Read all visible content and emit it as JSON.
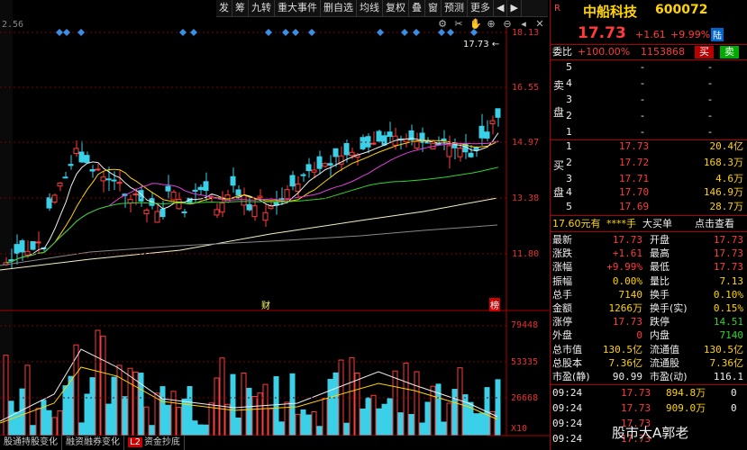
{
  "toolbar": {
    "items": [
      "发",
      "筹",
      "九转",
      "重大事件",
      "删自选",
      "均线",
      "复权",
      "叠",
      "窗",
      "预测",
      "更多"
    ],
    "active_index": 3
  },
  "icons": [
    "gear-icon",
    "scissors-icon",
    "hand-icon",
    "zoom-in-icon",
    "zoom-out-icon",
    "prev-icon",
    "close-icon"
  ],
  "chart": {
    "top_left_value": "2.56",
    "price_ticks": [
      "18.13",
      "16.55",
      "14.97",
      "13.38",
      "11.80"
    ],
    "price_marker": "17.73",
    "markers": {
      "cai": "财",
      "bang": "榜"
    },
    "volume_ticks": [
      "79448",
      "53335",
      "26668"
    ],
    "volume_unit": "X10"
  },
  "bottom_tabs": [
    {
      "label": "股通持股变化"
    },
    {
      "label": "融资融券变化"
    },
    {
      "num": "L2",
      "label": "资金抄底"
    }
  ],
  "quote": {
    "logo": "R",
    "name": "中船科技",
    "code": "600072",
    "price": "17.73",
    "change": "+1.61",
    "change_pct": "+9.99%",
    "exchange_badge": "陆",
    "ratio_label": "委比",
    "ratio_value": "+100.00%",
    "ratio_diff": "1153868",
    "buy_btn": "买",
    "sell_btn": "卖",
    "sell_label": [
      "卖",
      "盘"
    ],
    "buy_label": [
      "买",
      "盘"
    ],
    "sell_orders": [
      {
        "lvl": "5",
        "price": "-",
        "vol": "-"
      },
      {
        "lvl": "4",
        "price": "-",
        "vol": "-"
      },
      {
        "lvl": "3",
        "price": "-",
        "vol": "-"
      },
      {
        "lvl": "2",
        "price": "-",
        "vol": "-"
      },
      {
        "lvl": "1",
        "price": "-",
        "vol": "-"
      }
    ],
    "buy_orders": [
      {
        "lvl": "1",
        "price": "17.73",
        "vol": "20.4亿"
      },
      {
        "lvl": "2",
        "price": "17.72",
        "vol": "168.3万"
      },
      {
        "lvl": "3",
        "price": "17.71",
        "vol": "4.6万"
      },
      {
        "lvl": "4",
        "price": "17.70",
        "vol": "146.9万"
      },
      {
        "lvl": "5",
        "price": "17.69",
        "vol": "28.7万"
      }
    ],
    "big_order": {
      "text1": "17.60元有",
      "text2": "****手",
      "text3": "大买单",
      "link": "点击查看"
    },
    "stats": [
      {
        "l1": "最新",
        "v1": "17.73",
        "c1": "red",
        "l2": "开盘",
        "v2": "17.73",
        "c2": "red"
      },
      {
        "l1": "涨跌",
        "v1": "+1.61",
        "c1": "red",
        "l2": "最高",
        "v2": "17.73",
        "c2": "red"
      },
      {
        "l1": "涨幅",
        "v1": "+9.99%",
        "c1": "red",
        "l2": "最低",
        "v2": "17.73",
        "c2": "red"
      },
      {
        "l1": "振幅",
        "v1": "0.00%",
        "c1": "yellow",
        "l2": "量比",
        "v2": "7.13",
        "c2": "yellow"
      },
      {
        "l1": "总手",
        "v1": "7140",
        "c1": "yellow",
        "l2": "换手",
        "v2": "0.10%",
        "c2": "yellow"
      },
      {
        "l1": "金额",
        "v1": "1266万",
        "c1": "yellow",
        "l2": "换手(实)",
        "v2": "0.15%",
        "c2": "yellow"
      },
      {
        "l1": "涨停",
        "v1": "17.73",
        "c1": "red",
        "l2": "跌停",
        "v2": "14.51",
        "c2": "green"
      },
      {
        "l1": "外盘",
        "v1": "0",
        "c1": "red",
        "l2": "内盘",
        "v2": "7140",
        "c2": "green"
      },
      {
        "l1": "总市值",
        "v1": "130.5亿",
        "c1": "yellow",
        "l2": "流通值",
        "v2": "130.5亿",
        "c2": "yellow"
      },
      {
        "l1": "总股本",
        "v1": "7.36亿",
        "c1": "yellow",
        "l2": "流通股",
        "v2": "7.36亿",
        "c2": "yellow"
      },
      {
        "l1": "市盈(静)",
        "v1": "90.99",
        "c1": "white",
        "l2": "市盈(动)",
        "v2": "116.1",
        "c2": "white"
      }
    ],
    "ticks": [
      {
        "time": "09:24",
        "price": "17.73",
        "vol": "894.8万",
        "n": "0"
      },
      {
        "time": "09:24",
        "price": "17.73",
        "vol": "909.0万",
        "n": "0"
      },
      {
        "time": "09:24",
        "price": "17.73",
        "vol": "",
        "n": ""
      },
      {
        "time": "09:24",
        "price": "17.73",
        "vol": "",
        "n": ""
      }
    ],
    "watermark": "股市大A郭老"
  },
  "colors": {
    "up": "#ff3b3b",
    "down": "#3ad1e8",
    "bg": "#000000"
  }
}
